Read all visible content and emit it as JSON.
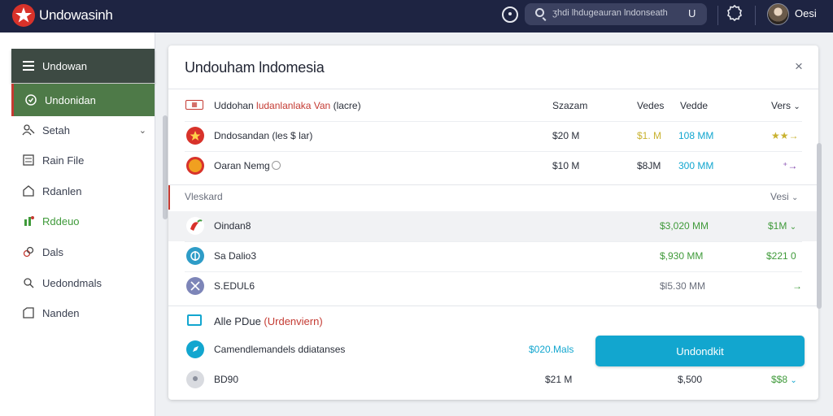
{
  "app": {
    "title": "Undowasinh",
    "user_name": "Oesi"
  },
  "search": {
    "text": "ʒhdi lhdugeauran lndonseath",
    "trailing": "U"
  },
  "sidebar": {
    "items": [
      {
        "label": "Undowan"
      },
      {
        "label": "Undonidan"
      },
      {
        "label": "Setah"
      },
      {
        "label": "Rain File"
      },
      {
        "label": "Rdanlen"
      },
      {
        "label": "Rddeuo"
      },
      {
        "label": "Dals"
      },
      {
        "label": "Uedondmals"
      },
      {
        "label": "Nanden"
      }
    ]
  },
  "panel": {
    "title": "Undouham lndomesia",
    "close": "×",
    "header": {
      "name_prefix": "Uddohan ",
      "name_highlight": "ludanlanlaka Van",
      "name_suffix": " (lacre)",
      "col1": "Szazam",
      "col2": "Vedes",
      "col3": "Vedde",
      "col4": "Vers"
    },
    "top_rows": [
      {
        "name": "Dndosandan (les $ lar)",
        "v1": "$20 M",
        "v2": "$1. M",
        "v3": "108 MM",
        "tail": "★★→"
      },
      {
        "name": "Oaran Nemg",
        "v1": "$10 M",
        "v2": "$8JM",
        "v3": "300 MM",
        "tail": "⁺→"
      }
    ],
    "section2": {
      "label": "Vleskard",
      "right": "Vesi"
    },
    "mid_rows": [
      {
        "name": "Oindan8",
        "v1": "$3,020 MM",
        "v2": "$1M"
      },
      {
        "name": "Sa Dalio3",
        "v1": "$,930 MM",
        "v2": "$221 0"
      },
      {
        "name": "S.EDUL6",
        "v1": "$l5.30 MM",
        "v2": "→"
      }
    ],
    "section3": {
      "prefix": "Alle PDue ",
      "highlight": "(Urdenviern)"
    },
    "bottom_rows": [
      {
        "name": "Camendlemandels ddiatanses",
        "v1": "$020.Mals"
      },
      {
        "name": "BD90",
        "v1": "$21 M",
        "v2": "$,500",
        "v3": "$$8"
      }
    ],
    "cta_label": "Undondkit"
  },
  "colors": {
    "topbar": "#1e2442",
    "sidebar_active": "#3d4a43",
    "sidebar_selected": "#4e7a48",
    "accent": "#12a6cf",
    "green": "#3f9a3a",
    "red": "#c43a32",
    "gold": "#c9b230"
  }
}
